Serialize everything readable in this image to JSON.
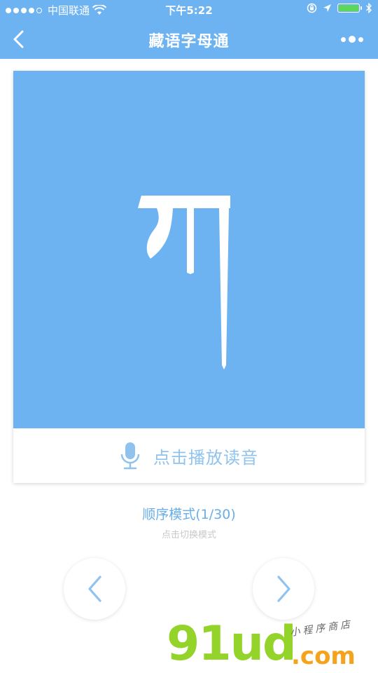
{
  "status_bar": {
    "carrier": "中国联通",
    "time": "下午5:22",
    "battery_level": 1.0,
    "icons": [
      "signal-dots-icon",
      "wifi-icon",
      "rotation-lock-icon",
      "location-arrow-icon",
      "battery-icon",
      "bluetooth-icon"
    ]
  },
  "nav": {
    "title": "藏语字母通",
    "back_icon": "chevron-left-icon",
    "more_icon": "more-dots-icon"
  },
  "card": {
    "letter": "ཀ",
    "play_label": "点击播放读音",
    "play_icon": "microphone-icon"
  },
  "mode": {
    "title": "顺序模式(1/30)",
    "hint": "点击切换模式"
  },
  "controls": {
    "prev_icon": "chevron-left-icon",
    "next_icon": "chevron-right-icon"
  },
  "watermark": {
    "main": "91ud",
    "com": ".com",
    "sub": "小程序商店"
  },
  "colors": {
    "primary": "#6db3f2",
    "accent_text": "#6aaee8",
    "hint_text": "#c9c9c9",
    "watermark_green": "#93d32a",
    "watermark_orange": "#f6a21a"
  }
}
